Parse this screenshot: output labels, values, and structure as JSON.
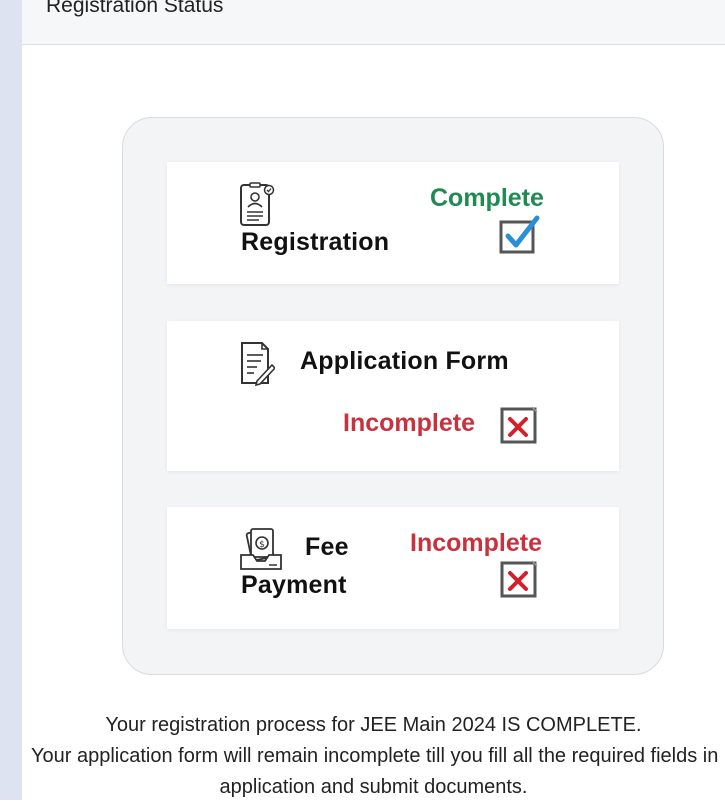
{
  "header": {
    "title": "Registration Status"
  },
  "steps": [
    {
      "label": "Registration",
      "status": "Complete",
      "status_color": "#1f8a52",
      "icon": "id-document-icon",
      "status_icon": "checked-box-icon"
    },
    {
      "label": "Application Form",
      "status": "Incomplete",
      "status_color": "#c8323f",
      "icon": "form-edit-icon",
      "status_icon": "crossed-box-icon"
    },
    {
      "label_line1": "Fee",
      "label_line2": "Payment",
      "status": "Incomplete",
      "status_color": "#c8323f",
      "icon": "money-payment-icon",
      "status_icon": "crossed-box-icon"
    }
  ],
  "footer": {
    "line1": "Your registration process for JEE Main 2024 IS COMPLETE.",
    "line2": "Your application form will remain incomplete till you fill all the required fields in",
    "line3": "application and submit documents."
  }
}
